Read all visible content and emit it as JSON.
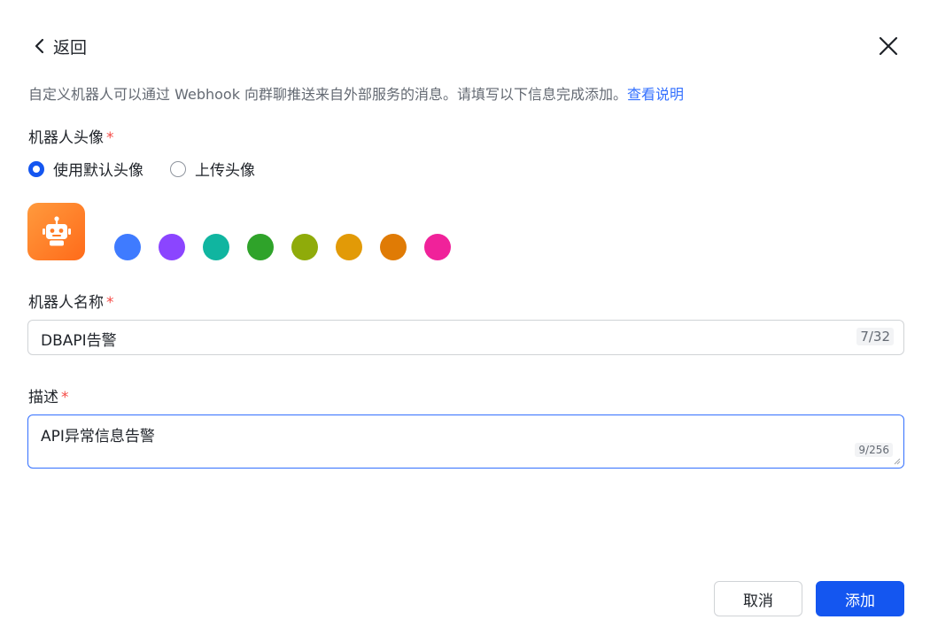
{
  "header": {
    "back_label": "返回"
  },
  "intro": {
    "text": "自定义机器人可以通过 Webhook 向群聊推送来自外部服务的消息。请填写以下信息完成添加。",
    "link_label": "查看说明"
  },
  "avatar_section": {
    "label": "机器人头像",
    "required_mark": "*",
    "options": [
      {
        "label": "使用默认头像",
        "selected": true
      },
      {
        "label": "上传头像",
        "selected": false
      }
    ],
    "avatar_color": "#ff7a24",
    "swatch_colors": [
      "#3f7bff",
      "#8b45ff",
      "#10b5a0",
      "#2fa32a",
      "#8fab0a",
      "#e29a07",
      "#e07b05",
      "#f0229a"
    ]
  },
  "name_field": {
    "label": "机器人名称",
    "required_mark": "*",
    "value": "DBAPI告警",
    "counter": "7/32"
  },
  "desc_field": {
    "label": "描述",
    "required_mark": "*",
    "value": "API异常信息告警",
    "counter": "9/256"
  },
  "footer": {
    "cancel_label": "取消",
    "add_label": "添加"
  },
  "colors": {
    "primary": "#1456f0",
    "link": "#3370ff",
    "required": "#f54a45"
  }
}
